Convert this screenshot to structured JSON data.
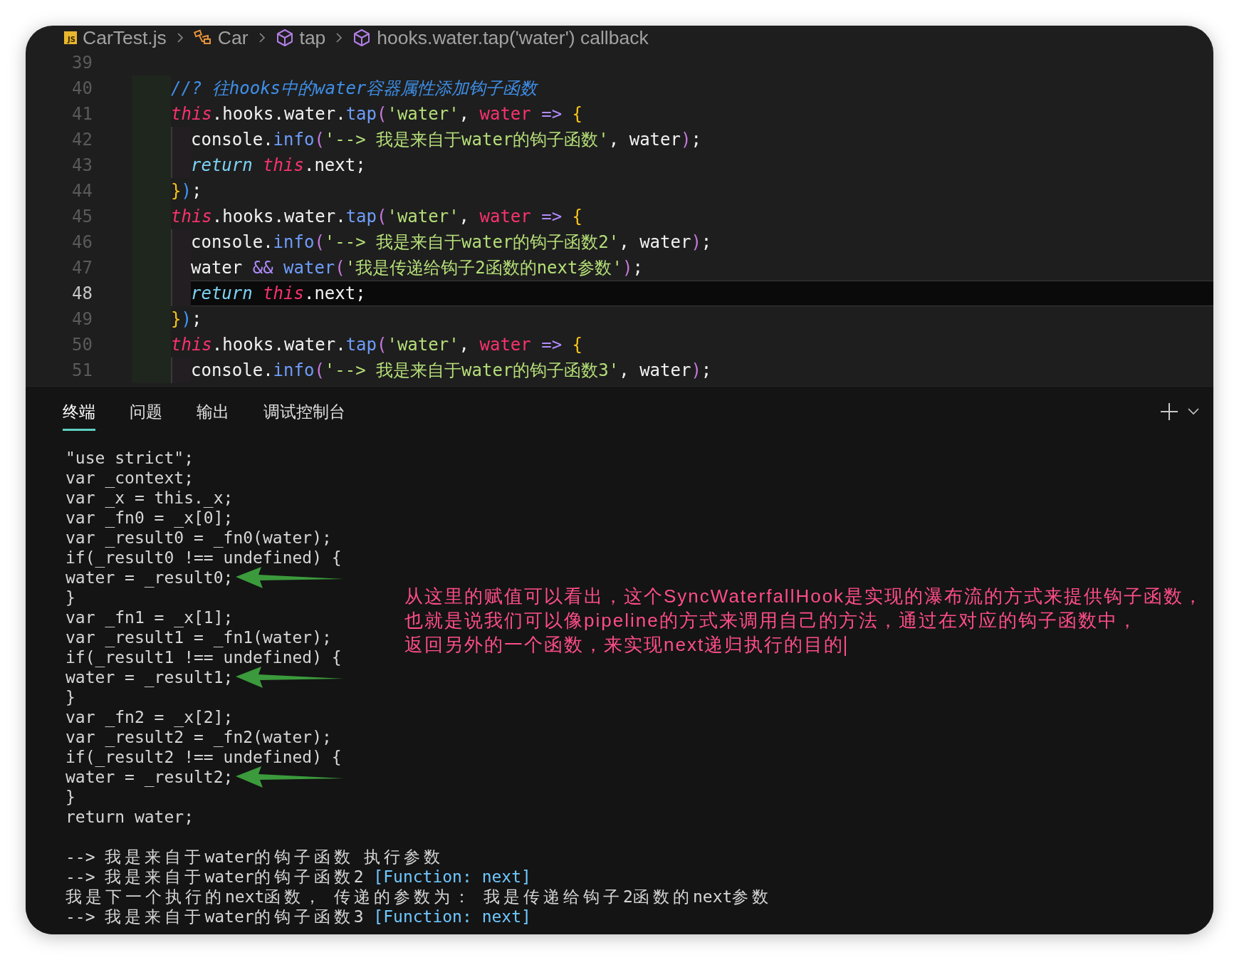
{
  "breadcrumb": [
    {
      "kind": "file",
      "badge": "JS",
      "label": "CarTest.js"
    },
    {
      "kind": "class",
      "label": "Car"
    },
    {
      "kind": "method",
      "label": "tap"
    },
    {
      "kind": "method",
      "label": "hooks.water.tap('water') callback"
    }
  ],
  "editor": {
    "lines": [
      {
        "number": "39",
        "current": false,
        "indented": false
      },
      {
        "number": "40",
        "current": false,
        "indented": false,
        "tokens": [
          {
            "text": "//? 往hooks中的water容器属性添加钩子函数",
            "kind": "comment"
          }
        ]
      },
      {
        "number": "41",
        "current": false,
        "indented": false,
        "tokens": [
          {
            "text": "this",
            "kind": "kw"
          },
          {
            "text": ".hooks.water.",
            "kind": "plain"
          },
          {
            "text": "tap",
            "kind": "fn"
          },
          {
            "text": "(",
            "kind": "paren"
          },
          {
            "text": "'water'",
            "kind": "str"
          },
          {
            "text": ", ",
            "kind": "plain"
          },
          {
            "text": "water",
            "kind": "param"
          },
          {
            "text": " => ",
            "kind": "op"
          },
          {
            "text": "{",
            "kind": "brace"
          }
        ]
      },
      {
        "number": "42",
        "current": false,
        "indented": true,
        "tokens": [
          {
            "text": "console.",
            "kind": "plain"
          },
          {
            "text": "info",
            "kind": "fn"
          },
          {
            "text": "(",
            "kind": "paren"
          },
          {
            "text": "'--> 我是来自于water的钩子函数'",
            "kind": "str"
          },
          {
            "text": ", water",
            "kind": "plain"
          },
          {
            "text": ")",
            "kind": "paren"
          },
          {
            "text": ";",
            "kind": "plain"
          }
        ]
      },
      {
        "number": "43",
        "current": false,
        "indented": true,
        "tokens": [
          {
            "text": "return ",
            "kind": "ret"
          },
          {
            "text": "this",
            "kind": "kw"
          },
          {
            "text": ".next;",
            "kind": "plain"
          }
        ]
      },
      {
        "number": "44",
        "current": false,
        "indented": false,
        "tokens": [
          {
            "text": "}",
            "kind": "brace"
          },
          {
            "text": ")",
            "kind": "paren2"
          },
          {
            "text": ";",
            "kind": "plain"
          }
        ]
      },
      {
        "number": "45",
        "current": false,
        "indented": false,
        "tokens": [
          {
            "text": "this",
            "kind": "kw"
          },
          {
            "text": ".hooks.water.",
            "kind": "plain"
          },
          {
            "text": "tap",
            "kind": "fn"
          },
          {
            "text": "(",
            "kind": "paren"
          },
          {
            "text": "'water'",
            "kind": "str"
          },
          {
            "text": ", ",
            "kind": "plain"
          },
          {
            "text": "water",
            "kind": "param"
          },
          {
            "text": " => ",
            "kind": "op"
          },
          {
            "text": "{",
            "kind": "brace"
          }
        ]
      },
      {
        "number": "46",
        "current": false,
        "indented": true,
        "tokens": [
          {
            "text": "console.",
            "kind": "plain"
          },
          {
            "text": "info",
            "kind": "fn"
          },
          {
            "text": "(",
            "kind": "paren"
          },
          {
            "text": "'--> 我是来自于water的钩子函数2'",
            "kind": "str"
          },
          {
            "text": ", water",
            "kind": "plain"
          },
          {
            "text": ")",
            "kind": "paren"
          },
          {
            "text": ";",
            "kind": "plain"
          }
        ]
      },
      {
        "number": "47",
        "current": false,
        "indented": true,
        "tokens": [
          {
            "text": "water ",
            "kind": "plain"
          },
          {
            "text": "&& ",
            "kind": "op"
          },
          {
            "text": "water",
            "kind": "fn"
          },
          {
            "text": "(",
            "kind": "paren"
          },
          {
            "text": "'我是传递给钩子2函数的next参数'",
            "kind": "str"
          },
          {
            "text": ")",
            "kind": "paren"
          },
          {
            "text": ";",
            "kind": "plain"
          }
        ]
      },
      {
        "number": "48",
        "current": true,
        "indented": true,
        "tokens": [
          {
            "text": "return ",
            "kind": "ret"
          },
          {
            "text": "this",
            "kind": "kw"
          },
          {
            "text": ".next;",
            "kind": "plain"
          }
        ]
      },
      {
        "number": "49",
        "current": false,
        "indented": false,
        "tokens": [
          {
            "text": "}",
            "kind": "brace"
          },
          {
            "text": ")",
            "kind": "paren2"
          },
          {
            "text": ";",
            "kind": "plain"
          }
        ]
      },
      {
        "number": "50",
        "current": false,
        "indented": false,
        "tokens": [
          {
            "text": "this",
            "kind": "kw"
          },
          {
            "text": ".hooks.water.",
            "kind": "plain"
          },
          {
            "text": "tap",
            "kind": "fn"
          },
          {
            "text": "(",
            "kind": "paren"
          },
          {
            "text": "'water'",
            "kind": "str"
          },
          {
            "text": ", ",
            "kind": "plain"
          },
          {
            "text": "water",
            "kind": "param"
          },
          {
            "text": " => ",
            "kind": "op"
          },
          {
            "text": "{",
            "kind": "brace"
          }
        ]
      },
      {
        "number": "51",
        "current": false,
        "indented": true,
        "tokens": [
          {
            "text": "console.",
            "kind": "plain"
          },
          {
            "text": "info",
            "kind": "fn"
          },
          {
            "text": "(",
            "kind": "paren"
          },
          {
            "text": "'--> 我是来自于water的钩子函数3'",
            "kind": "str"
          },
          {
            "text": ", water",
            "kind": "plain"
          },
          {
            "text": ")",
            "kind": "paren"
          },
          {
            "text": ";",
            "kind": "plain"
          }
        ]
      }
    ]
  },
  "panel": {
    "tabs": [
      {
        "label": "终端",
        "selected": true
      },
      {
        "label": "问题",
        "selected": false
      },
      {
        "label": "输出",
        "selected": false
      },
      {
        "label": "调试控制台",
        "selected": false
      }
    ],
    "terminal": {
      "code_lines": [
        {
          "text": "\"use strict\";",
          "arrow": false
        },
        {
          "text": "var _context;",
          "arrow": false
        },
        {
          "text": "var _x = this._x;",
          "arrow": false
        },
        {
          "text": "var _fn0 = _x[0];",
          "arrow": false
        },
        {
          "text": "var _result0 = _fn0(water);",
          "arrow": false
        },
        {
          "text": "if(_result0 !== undefined) {",
          "arrow": false
        },
        {
          "text": "water = _result0;",
          "arrow": true
        },
        {
          "text": "}",
          "arrow": false
        },
        {
          "text": "var _fn1 = _x[1];",
          "arrow": false
        },
        {
          "text": "var _result1 = _fn1(water);",
          "arrow": false
        },
        {
          "text": "if(_result1 !== undefined) {",
          "arrow": false
        },
        {
          "text": "water = _result1;",
          "arrow": true
        },
        {
          "text": "}",
          "arrow": false
        },
        {
          "text": "var _fn2 = _x[2];",
          "arrow": false
        },
        {
          "text": "var _result2 = _fn2(water);",
          "arrow": false
        },
        {
          "text": "if(_result2 !== undefined) {",
          "arrow": false
        },
        {
          "text": "water = _result2;",
          "arrow": true
        },
        {
          "text": "}",
          "arrow": false
        },
        {
          "text": "return water;",
          "arrow": false
        }
      ],
      "annotation": {
        "lines": [
          "从这里的赋值可以看出，这个SyncWaterfallHook是实现的瀑布流的方式来提供钩子函数，",
          "也就是说我们可以像pipeline的方式来调用自己的方法，通过在对应的钩子函数中，",
          "返回另外的一个函数，来实现next递归执行的目的"
        ]
      },
      "output_lines": [
        {
          "segments": [
            {
              "text": "--> 我是来自于water的钩子函数 执行参数",
              "kind": "plain"
            }
          ]
        },
        {
          "segments": [
            {
              "text": "--> 我是来自于water的钩子函数2 ",
              "kind": "plain"
            },
            {
              "text": "[Function: next]",
              "kind": "function"
            }
          ]
        },
        {
          "segments": [
            {
              "text": "我是下一个执行的next函数， 传递的参数为： 我是传递给钩子2函数的next参数",
              "kind": "plain"
            }
          ]
        },
        {
          "segments": [
            {
              "text": "--> 我是来自于water的钩子函数3 ",
              "kind": "plain"
            },
            {
              "text": "[Function: next]",
              "kind": "function"
            }
          ]
        }
      ]
    }
  }
}
